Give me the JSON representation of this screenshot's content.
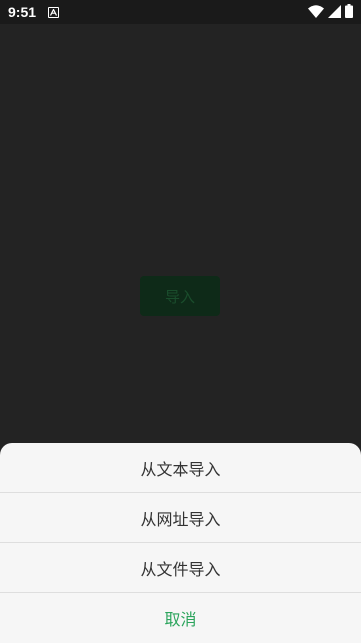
{
  "status_bar": {
    "time": "9:51",
    "notification_icon": "a-square-icon",
    "indicators": [
      "wifi-icon",
      "signal-icon",
      "battery-icon"
    ]
  },
  "main": {
    "import_button_label": "导入"
  },
  "action_sheet": {
    "items": [
      {
        "label": "从文本导入"
      },
      {
        "label": "从网址导入"
      },
      {
        "label": "从文件导入"
      }
    ],
    "cancel_label": "取消"
  },
  "colors": {
    "status_bar_bg": "#1a1a1a",
    "app_bg": "#232323",
    "sheet_bg": "#f6f6f6",
    "accent": "#2ba45c"
  }
}
